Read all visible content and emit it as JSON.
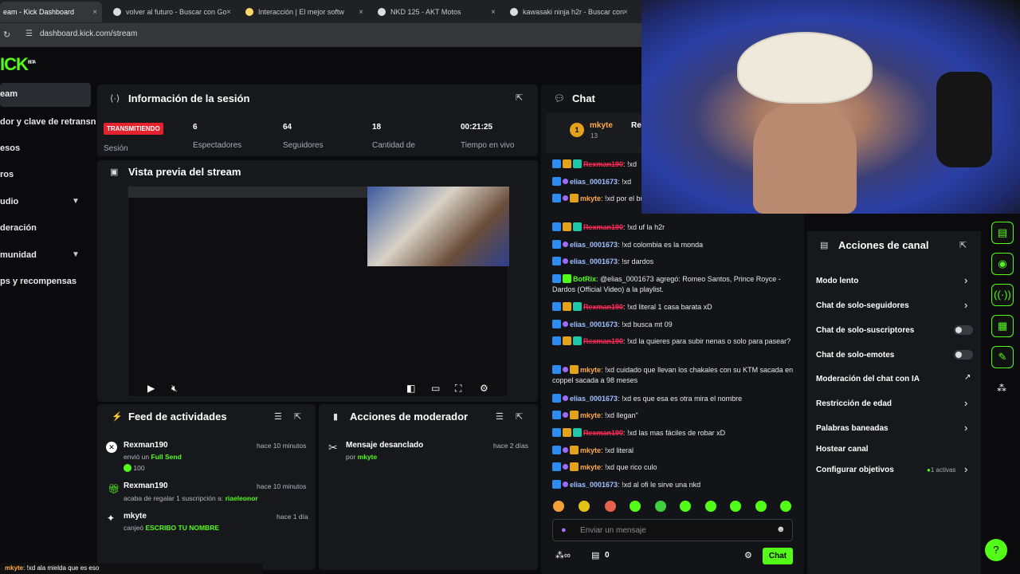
{
  "browser": {
    "tabs": [
      {
        "title": "eam - Kick Dashboard",
        "close": "×"
      },
      {
        "title": "volver al futuro - Buscar con Go",
        "close": "×"
      },
      {
        "title": "Interacción | El mejor softw",
        "close": "×"
      },
      {
        "title": "NKD 125 - AKT Motos",
        "close": "×"
      },
      {
        "title": "kawasaki ninja h2r - Buscar con",
        "close": "×"
      }
    ],
    "url": "dashboard.kick.com/stream"
  },
  "logo": "ICK",
  "logo_beta": "BETA",
  "sidebar": {
    "items": [
      {
        "label": "eam"
      },
      {
        "label": "dor y clave de retransn"
      },
      {
        "label": "esos"
      },
      {
        "label": "ros"
      },
      {
        "label": "udio"
      },
      {
        "label": "deración"
      },
      {
        "label": "munidad"
      },
      {
        "label": "ps y recompensas"
      }
    ]
  },
  "session": {
    "title": "Información de la sesión",
    "status": "TRANSMITIENDO",
    "status_label": "Sesión",
    "stats": [
      {
        "value": "6",
        "label": "Espectadores"
      },
      {
        "value": "64",
        "label": "Seguidores"
      },
      {
        "value": "18",
        "label": "Cantidad de"
      },
      {
        "value": "00:21:25",
        "label": "Tiempo en vivo"
      }
    ]
  },
  "preview": {
    "title": "Vista previa del stream"
  },
  "activity": {
    "title": "Feed de actividades",
    "items": [
      {
        "name": "Rexman190",
        "time": "hace 10 minutos",
        "text": "envió un",
        "highlight": "Full Send",
        "amount": "100"
      },
      {
        "name": "Rexman190",
        "time": "hace 10 minutos",
        "text": "acaba de regalar 1 suscripción a:",
        "highlight": "riaeleonor"
      },
      {
        "name": "mkyte",
        "time": "hace 1 día",
        "text": "canjeó",
        "highlight": "ESCRIBO TU NOMBRE"
      }
    ]
  },
  "moderator": {
    "title": "Acciones de moderador",
    "items": [
      {
        "title": "Mensaje desanclado",
        "by_label": "por",
        "by": "mkyte",
        "time": "hace 2 días"
      }
    ]
  },
  "chat": {
    "title": "Chat",
    "pinned_user": "mkyte",
    "pinned_count": "13",
    "pinned_extra": "Re",
    "messages": [
      {
        "user": "Rexman190",
        "style": "red",
        "badges": [
          "blue",
          "gold",
          "teal"
        ],
        "text": ": !xd"
      },
      {
        "user": "elias_0001673",
        "style": "blue",
        "badges": [
          "blue",
          "purple"
        ],
        "text": ": !xd"
      },
      {
        "user": "mkyte",
        "style": "orange",
        "badges": [
          "blue",
          "purple",
          "gold"
        ],
        "text": ": !xd por el buenas?"
      },
      {
        "user": "Rexman190",
        "style": "red",
        "badges": [
          "blue",
          "gold",
          "teal"
        ],
        "text": ": !xd uf la h2r"
      },
      {
        "user": "elias_0001673",
        "style": "blue",
        "badges": [
          "blue",
          "purple"
        ],
        "text": ": !xd colombia es la monda"
      },
      {
        "user": "elias_0001673",
        "style": "blue",
        "badges": [
          "blue",
          "purple"
        ],
        "text": ": !sr dardos"
      },
      {
        "user": "BotRix",
        "style": "green",
        "badges": [
          "blue",
          "green"
        ],
        "text": ": @elias_0001673 agregó: Romeo Santos, Prince Royce - Dardos (Official Video) a la playlist."
      },
      {
        "user": "Rexman190",
        "style": "red",
        "badges": [
          "blue",
          "gold",
          "teal"
        ],
        "text": ": !xd literal 1 casa barata xD"
      },
      {
        "user": "elias_0001673",
        "style": "blue",
        "badges": [
          "blue",
          "purple"
        ],
        "text": ": !xd busca mt 09"
      },
      {
        "user": "Rexman190",
        "style": "red",
        "badges": [
          "blue",
          "gold",
          "teal"
        ],
        "text": ": !xd la quieres para subir nenas o solo para pasear?"
      },
      {
        "user": "mkyte",
        "style": "orange",
        "badges": [
          "blue",
          "purple",
          "gold"
        ],
        "text": ": !xd cuidado que llevan los chakales con su KTM sacada en coppel sacada a 98 meses"
      },
      {
        "user": "elias_0001673",
        "style": "blue",
        "badges": [
          "blue",
          "purple"
        ],
        "text": ": !xd es que esa es otra mira el nombre"
      },
      {
        "user": "mkyte",
        "style": "orange",
        "badges": [
          "blue",
          "purple",
          "gold"
        ],
        "text": ": !xd llegan\""
      },
      {
        "user": "Rexman190",
        "style": "red",
        "badges": [
          "blue",
          "gold",
          "teal"
        ],
        "text": ": !xd las mas fáciles de robar xD"
      },
      {
        "user": "mkyte",
        "style": "orange",
        "badges": [
          "blue",
          "purple",
          "gold"
        ],
        "text": ": !xd literal"
      },
      {
        "user": "mkyte",
        "style": "orange",
        "badges": [
          "blue",
          "purple",
          "gold"
        ],
        "text": ": !xd que rico culo"
      },
      {
        "user": "elias_0001673",
        "style": "blue",
        "badges": [
          "blue",
          "purple"
        ],
        "text": ": !xd al ofi le sirve una nkd"
      }
    ],
    "input_placeholder": "Enviar un mensaje",
    "points": "0",
    "send_label": "Chat"
  },
  "channel_actions": {
    "title": "Acciones de canal",
    "items": [
      {
        "label": "Modo lento",
        "control": "arrow"
      },
      {
        "label": "Chat de solo-seguidores",
        "control": "arrow"
      },
      {
        "label": "Chat de solo-suscriptores",
        "control": "toggle"
      },
      {
        "label": "Chat de solo-emotes",
        "control": "toggle"
      },
      {
        "label": "Moderación del chat con IA",
        "control": "external"
      },
      {
        "label": "Restricción de edad",
        "control": "arrow"
      },
      {
        "label": "Palabras baneadas",
        "control": "arrow"
      },
      {
        "label": "Hostear canal",
        "control": "none"
      },
      {
        "label": "Configurar objetivos",
        "control": "arrow",
        "extra": "1 activas"
      }
    ]
  },
  "ticker": {
    "user": "mkyte",
    "text": ": !xd ala mielda que es eso"
  },
  "colors": {
    "accent": "#53fc18",
    "live": "#e4222e",
    "panel": "#17181c"
  }
}
